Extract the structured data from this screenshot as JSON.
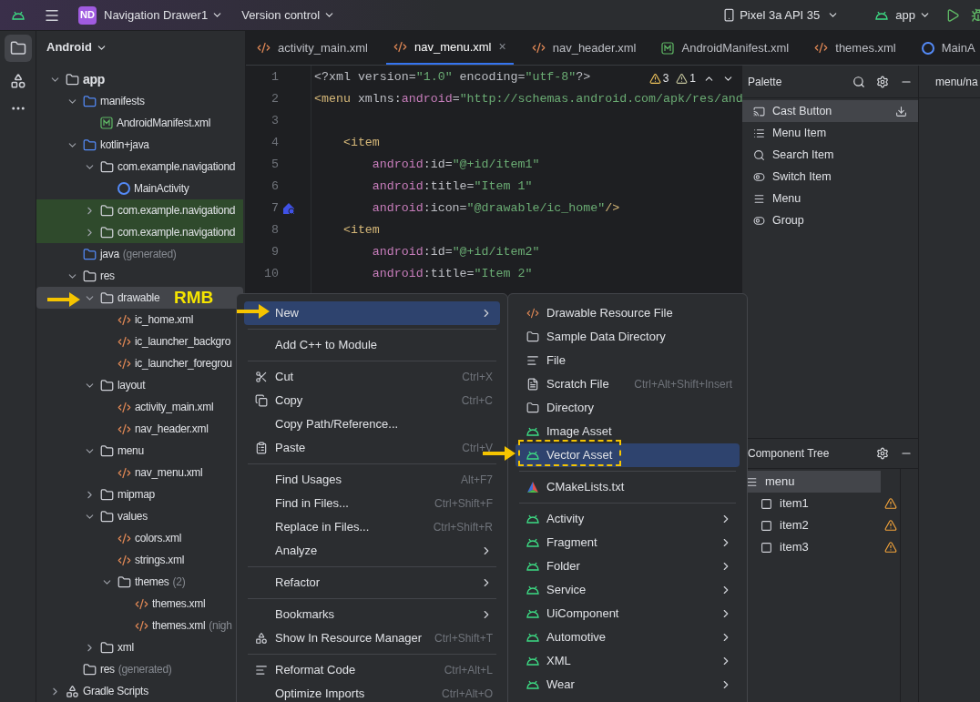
{
  "toolbar": {
    "project_badge": "ND",
    "project": "Navigation Drawer1",
    "vcs": "Version control",
    "device": "Pixel 3a API 35",
    "run_config": "app"
  },
  "project_panel": {
    "view": "Android",
    "tree": [
      {
        "label": "app",
        "kind": "module",
        "expanded": true,
        "selected": false,
        "highlighted": false,
        "children": [
          {
            "label": "manifests",
            "kind": "folder",
            "expanded": true,
            "selected": false,
            "highlighted": false,
            "children": [
              {
                "label": "AndroidManifest.xml",
                "kind": "manifest",
                "selected": false,
                "highlighted": false
              }
            ]
          },
          {
            "label": "kotlin+java",
            "kind": "folder",
            "expanded": true,
            "selected": false,
            "highlighted": false,
            "children": [
              {
                "label": "com.example.navigationd",
                "kind": "package",
                "expanded": true,
                "selected": false,
                "highlighted": false,
                "children": [
                  {
                    "label": "MainActivity",
                    "kind": "class",
                    "selected": false,
                    "highlighted": false
                  }
                ]
              },
              {
                "label": "com.example.navigationd",
                "kind": "package",
                "expanded": false,
                "selected": false,
                "highlighted": true
              },
              {
                "label": "com.example.navigationd",
                "kind": "package",
                "expanded": false,
                "selected": false,
                "highlighted": true
              }
            ]
          },
          {
            "label": "java",
            "suffix": "(generated)",
            "kind": "generated",
            "selected": false,
            "highlighted": false
          },
          {
            "label": "res",
            "kind": "resfolder",
            "expanded": true,
            "selected": false,
            "highlighted": false,
            "children": [
              {
                "label": "drawable",
                "kind": "package",
                "expanded": true,
                "selected": true,
                "highlighted": false,
                "children": [
                  {
                    "label": "ic_home.xml",
                    "kind": "xml",
                    "selected": false,
                    "highlighted": false
                  },
                  {
                    "label": "ic_launcher_backgro",
                    "kind": "xml",
                    "selected": false,
                    "highlighted": false
                  },
                  {
                    "label": "ic_launcher_foregrou",
                    "kind": "xml",
                    "selected": false,
                    "highlighted": false
                  }
                ]
              },
              {
                "label": "layout",
                "kind": "package",
                "expanded": true,
                "selected": false,
                "highlighted": false,
                "children": [
                  {
                    "label": "activity_main.xml",
                    "kind": "xml",
                    "selected": false,
                    "highlighted": false
                  },
                  {
                    "label": "nav_header.xml",
                    "kind": "xml",
                    "selected": false,
                    "highlighted": false
                  }
                ]
              },
              {
                "label": "menu",
                "kind": "package",
                "expanded": true,
                "selected": false,
                "highlighted": false,
                "children": [
                  {
                    "label": "nav_menu.xml",
                    "kind": "xml",
                    "selected": false,
                    "highlighted": false
                  }
                ]
              },
              {
                "label": "mipmap",
                "kind": "package",
                "expanded": false,
                "selected": false,
                "highlighted": false
              },
              {
                "label": "values",
                "kind": "package",
                "expanded": true,
                "selected": false,
                "highlighted": false,
                "children": [
                  {
                    "label": "colors.xml",
                    "kind": "xml",
                    "selected": false,
                    "highlighted": false
                  },
                  {
                    "label": "strings.xml",
                    "kind": "xml",
                    "selected": false,
                    "highlighted": false
                  },
                  {
                    "label": "themes",
                    "suffix": "(2)",
                    "kind": "package",
                    "expanded": true,
                    "selected": false,
                    "highlighted": false,
                    "children": [
                      {
                        "label": "themes.xml",
                        "kind": "xml",
                        "selected": false,
                        "highlighted": false
                      },
                      {
                        "label": "themes.xml",
                        "suffix": "(nigh",
                        "kind": "xml",
                        "selected": false,
                        "highlighted": false
                      }
                    ]
                  }
                ]
              },
              {
                "label": "xml",
                "kind": "package",
                "expanded": false,
                "selected": false,
                "highlighted": false
              }
            ]
          },
          {
            "label": "res",
            "suffix": "(generated)",
            "kind": "resfolder",
            "selected": false,
            "highlighted": false
          }
        ]
      },
      {
        "label": "Gradle Scripts",
        "kind": "gradle",
        "expanded": false,
        "selected": false,
        "highlighted": false
      }
    ]
  },
  "editor": {
    "tabs": [
      {
        "label": "activity_main.xml",
        "kind": "xml",
        "selected": false
      },
      {
        "label": "nav_menu.xml",
        "kind": "xml",
        "selected": true,
        "close": "×"
      },
      {
        "label": "nav_header.xml",
        "kind": "xml",
        "selected": false
      },
      {
        "label": "AndroidManifest.xml",
        "kind": "manifest",
        "selected": false
      },
      {
        "label": "themes.xml",
        "kind": "xml",
        "selected": false
      },
      {
        "label": "MainA",
        "kind": "class",
        "selected": false
      }
    ],
    "warnings": [
      "3",
      "1"
    ],
    "lines": [
      {
        "number": "1",
        "tokens": [
          {
            "text": "<?xml version=",
            "kind": "plain"
          },
          {
            "text": "\"1.0\"",
            "kind": "string"
          },
          {
            "text": " encoding=",
            "kind": "plain"
          },
          {
            "text": "\"utf-8\"",
            "kind": "string"
          },
          {
            "text": "?>",
            "kind": "plain"
          }
        ]
      },
      {
        "number": "2",
        "tokens": [
          {
            "text": "<menu ",
            "kind": "tag"
          },
          {
            "text": "xmlns:",
            "kind": "plain"
          },
          {
            "text": "android",
            "kind": "attr"
          },
          {
            "text": "=",
            "kind": "plain"
          },
          {
            "text": "\"http://schemas.android.com/apk/res/and",
            "kind": "string"
          }
        ]
      },
      {
        "number": "3"
      },
      {
        "number": "4",
        "tokens": [
          {
            "text": "    <item",
            "kind": "tag"
          }
        ]
      },
      {
        "number": "5",
        "tokens": [
          {
            "text": "        android",
            "kind": "attr"
          },
          {
            "text": ":id=",
            "kind": "plain"
          },
          {
            "text": "\"@+id/item1\"",
            "kind": "string"
          }
        ]
      },
      {
        "number": "6",
        "tokens": [
          {
            "text": "        android",
            "kind": "attr"
          },
          {
            "text": ":title=",
            "kind": "plain"
          },
          {
            "text": "\"Item 1\"",
            "kind": "string"
          }
        ]
      },
      {
        "number": "7",
        "gutter_icon": true,
        "tokens": [
          {
            "text": "        android",
            "kind": "attr"
          },
          {
            "text": ":icon=",
            "kind": "plain"
          },
          {
            "text": "\"@drawable/ic_home\"",
            "kind": "string"
          },
          {
            "text": "/>",
            "kind": "tag"
          }
        ]
      },
      {
        "number": "8",
        "tokens": [
          {
            "text": "    <item",
            "kind": "tag"
          }
        ]
      },
      {
        "number": "9",
        "tokens": [
          {
            "text": "        android",
            "kind": "attr"
          },
          {
            "text": ":id=",
            "kind": "plain"
          },
          {
            "text": "\"@+id/item2\"",
            "kind": "string"
          }
        ]
      },
      {
        "number": "10",
        "tokens": [
          {
            "text": "        android",
            "kind": "attr"
          },
          {
            "text": ":title=",
            "kind": "plain"
          },
          {
            "text": "\"Item 2\"",
            "kind": "string"
          }
        ]
      }
    ]
  },
  "palette": {
    "title": "Palette",
    "items": [
      {
        "label": "Cast Button",
        "kind": "cast",
        "selected": true
      },
      {
        "label": "Menu Item",
        "kind": "list",
        "selected": false
      },
      {
        "label": "Search Item",
        "kind": "search",
        "selected": false
      },
      {
        "label": "Switch Item",
        "kind": "toggle",
        "selected": false
      },
      {
        "label": "Menu",
        "kind": "menu",
        "selected": false
      },
      {
        "label": "Group",
        "kind": "toggle",
        "selected": false
      }
    ]
  },
  "design_path": "menu/na",
  "component_tree": {
    "title": "Component Tree",
    "root": {
      "label": "menu",
      "selected": true
    },
    "items": [
      {
        "label": "item1",
        "warning": true
      },
      {
        "label": "item2",
        "warning": true
      },
      {
        "label": "item3",
        "warning": true
      }
    ]
  },
  "context_menu": {
    "items": [
      {
        "kind": "plain",
        "label": "New",
        "submenu": true,
        "selected": true
      },
      {
        "kind": "separator"
      },
      {
        "kind": "plain",
        "label": "Add C++ to Module",
        "selected": false
      },
      {
        "kind": "separator"
      },
      {
        "kind": "cut",
        "label": "Cut",
        "shortcut": "Ctrl+X",
        "selected": false
      },
      {
        "kind": "copy",
        "label": "Copy",
        "shortcut": "Ctrl+C",
        "selected": false
      },
      {
        "kind": "plain",
        "label": "Copy Path/Reference...",
        "selected": false
      },
      {
        "kind": "paste",
        "label": "Paste",
        "shortcut": "Ctrl+V",
        "selected": false
      },
      {
        "kind": "separator"
      },
      {
        "kind": "plain",
        "label": "Find Usages",
        "shortcut": "Alt+F7",
        "selected": false
      },
      {
        "kind": "plain",
        "label": "Find in Files...",
        "shortcut": "Ctrl+Shift+F",
        "selected": false
      },
      {
        "kind": "plain",
        "label": "Replace in Files...",
        "shortcut": "Ctrl+Shift+R",
        "selected": false
      },
      {
        "kind": "plain",
        "label": "Analyze",
        "submenu": true,
        "selected": false
      },
      {
        "kind": "separator"
      },
      {
        "kind": "plain",
        "label": "Refactor",
        "submenu": true,
        "selected": false
      },
      {
        "kind": "separator"
      },
      {
        "kind": "plain",
        "label": "Bookmarks",
        "submenu": true,
        "selected": false
      },
      {
        "kind": "resources",
        "label": "Show In Resource Manager",
        "shortcut": "Ctrl+Shift+T",
        "selected": false
      },
      {
        "kind": "separator"
      },
      {
        "kind": "reformat",
        "label": "Reformat Code",
        "shortcut": "Ctrl+Alt+L",
        "selected": false
      },
      {
        "kind": "plain",
        "label": "Optimize Imports",
        "shortcut": "Ctrl+Alt+O",
        "selected": false
      }
    ]
  },
  "submenu": {
    "items": [
      {
        "kind": "xml",
        "label": "Drawable Resource File",
        "selected": false
      },
      {
        "kind": "folder",
        "label": "Sample Data Directory",
        "selected": false
      },
      {
        "kind": "file",
        "label": "File",
        "selected": false
      },
      {
        "kind": "scratch",
        "label": "Scratch File",
        "shortcut": "Ctrl+Alt+Shift+Insert",
        "selected": false
      },
      {
        "kind": "folder",
        "label": "Directory",
        "selected": false
      },
      {
        "kind": "android",
        "label": "Image Asset",
        "selected": false
      },
      {
        "kind": "android",
        "label": "Vector Asset",
        "selected": true,
        "callout": true
      },
      {
        "kind": "separator"
      },
      {
        "kind": "cmake",
        "label": "CMakeLists.txt",
        "selected": false
      },
      {
        "kind": "separator"
      },
      {
        "kind": "android",
        "label": "Activity",
        "submenu": true,
        "selected": false
      },
      {
        "kind": "android",
        "label": "Fragment",
        "submenu": true,
        "selected": false
      },
      {
        "kind": "android",
        "label": "Folder",
        "submenu": true,
        "selected": false
      },
      {
        "kind": "android",
        "label": "Service",
        "submenu": true,
        "selected": false
      },
      {
        "kind": "android",
        "label": "UiComponent",
        "submenu": true,
        "selected": false
      },
      {
        "kind": "android",
        "label": "Automotive",
        "submenu": true,
        "selected": false
      },
      {
        "kind": "android",
        "label": "XML",
        "submenu": true,
        "selected": false
      },
      {
        "kind": "android",
        "label": "Wear",
        "submenu": true,
        "selected": false
      }
    ]
  },
  "annotation": {
    "label": "RMB"
  }
}
